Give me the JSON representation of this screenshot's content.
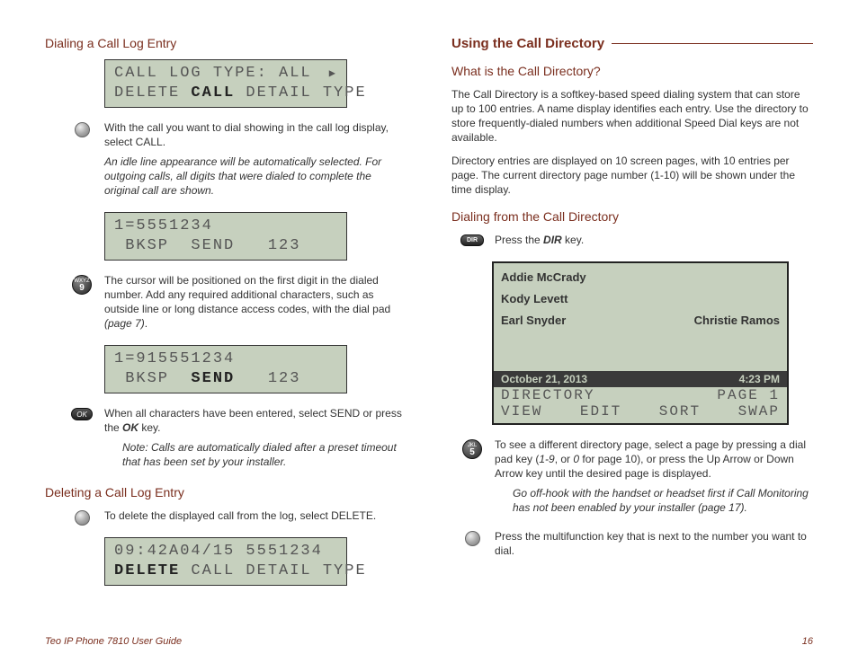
{
  "left": {
    "h_dialing": "Dialing a Call Log Entry",
    "lcd1": {
      "line1_pre": "CALL LOG TYPE: ALL",
      "line2_pre": "DELETE ",
      "line2_bold": "CALL",
      "line2_post": " DETAIL TYPE"
    },
    "step1": "With the call you want to dial showing in the call log display, select CALL.",
    "step1_note": "An idle line appearance will be automatically selected. For outgoing calls, all digits that were dialed to complete the original call are shown.",
    "lcd2": {
      "line1": "1=5551234",
      "line2": " BKSP  SEND   123"
    },
    "step2_pre": "The cursor will be positioned on the first digit in the dialed number. Add any required additional characters, such as outside line or long distance access codes, with the dial pad ",
    "step2_ref": "(page 7)",
    "step2_post": ".",
    "key9_letters": "WXYZ",
    "key9_num": "9",
    "lcd3": {
      "line1": "1=915551234",
      "line2_pre": " BKSP  ",
      "line2_bold": "SEND",
      "line2_post": "   123"
    },
    "step3_pre": "When all characters have been entered, select SEND or press the ",
    "step3_key": "OK",
    "step3_post": " key.",
    "ok_label": "OK",
    "step3_note": "Note: Calls are automatically dialed after a preset timeout that has been set by your installer.",
    "h_deleting": "Deleting a Call Log Entry",
    "del_step": "To delete the displayed call from the log, select DELETE.",
    "lcd4": {
      "line1": "09:42A04/15 5551234",
      "line2_bold": "DELETE",
      "line2_post": " CALL DETAIL TYPE"
    }
  },
  "right": {
    "h_main": "Using the Call Directory",
    "h_what": "What is the Call Directory?",
    "p1": "The Call Directory is a softkey-based speed dialing system that can store up to 100 entries. A name display identifies each entry. Use the directory to store frequently-dialed numbers when additional Speed Dial keys are not available.",
    "p2": "Directory entries are displayed on 10 screen pages, with 10 entries per page. The current directory page number (1-10) will be shown under the time display.",
    "h_dialfrom": "Dialing from the Call Directory",
    "dir_btn": "DIR",
    "dirstep_pre": "Press the ",
    "dirstep_key": "DIR",
    "dirstep_post": " key.",
    "lcd": {
      "names": [
        "Addie McCrady",
        "Kody Levett",
        "Earl Snyder"
      ],
      "name_right": "Christie Ramos",
      "date": "October 21, 2013",
      "time": "4:23 PM",
      "status_l": "DIRECTORY",
      "status_r": "PAGE 1",
      "softkeys": [
        "VIEW",
        "EDIT",
        "SORT",
        "SWAP"
      ]
    },
    "key5_letters": "JKL",
    "key5_num": "5",
    "pagestep_pre": "To see a different directory page, select a page by pressing a dial pad key (",
    "pagestep_range": "1-9",
    "pagestep_mid": ", or ",
    "pagestep_zero": "0",
    "pagestep_post": " for page 10), or press the Up Arrow or Down Arrow key until the desired page is displayed.",
    "pagestep_note_pre": "Go off-hook with the handset or headset first if Call Monitoring has not been enabled by your installer ",
    "pagestep_note_ref": "(page 17)",
    "pagestep_note_post": ".",
    "finalstep": "Press the multifunction key that is next to the number you want to dial."
  },
  "footer": {
    "title": "Teo IP Phone 7810 User Guide",
    "page": "16"
  }
}
